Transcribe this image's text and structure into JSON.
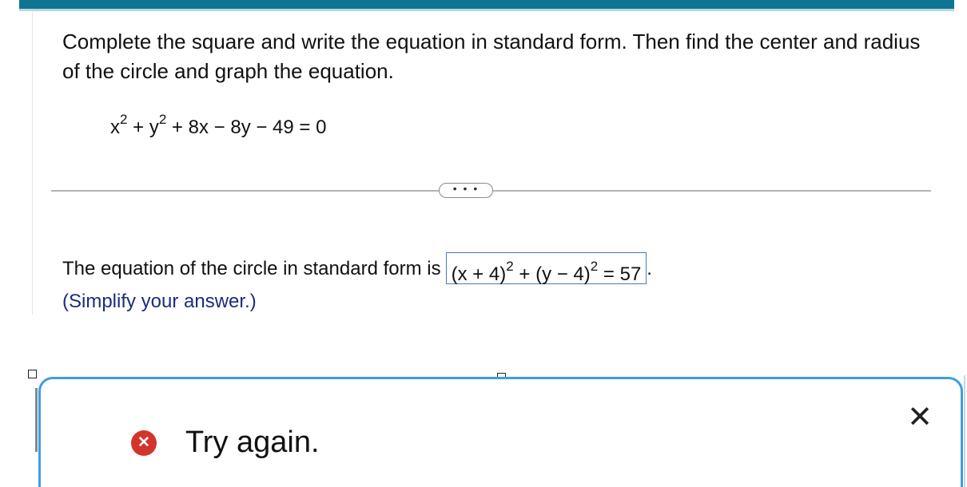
{
  "question": {
    "text": "Complete the square and write the equation in standard form. Then find the center and radius of the circle and graph the equation.",
    "equation": {
      "x_term": "x",
      "x_exp": "2",
      "plus_1": " + ",
      "y_term": "y",
      "y_exp": "2",
      "rest": " + 8x − 8y − 49 = 0"
    }
  },
  "more_button": {
    "label": "• • •"
  },
  "answer": {
    "prompt": "The equation of the circle in standard form is",
    "box": {
      "part1": "(x + 4)",
      "exp1": "2",
      "middle": " + (y − 4)",
      "exp2": "2",
      "end": " = 57"
    },
    "period": ".",
    "hint": "(Simplify your answer.)"
  },
  "feedback": {
    "icon_glyph": "✕",
    "message": "Try again.",
    "close_glyph": "✕"
  },
  "colors": {
    "top_bar": "#0f7592",
    "answer_box_border": "#4a79c4",
    "hint_text": "#1a2d7c",
    "feedback_border": "#3f9ee0",
    "error_icon": "#d3342c"
  }
}
